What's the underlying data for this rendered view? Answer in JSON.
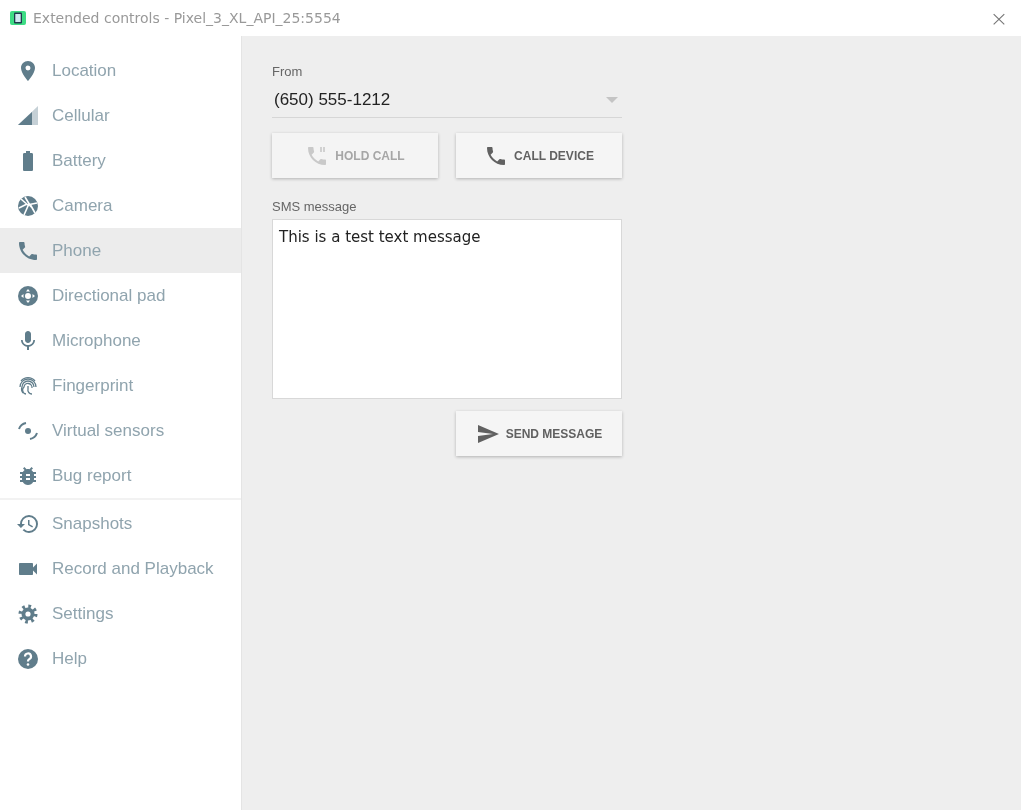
{
  "window": {
    "title": "Extended controls - Pixel_3_XL_API_25:5554",
    "close": "×"
  },
  "sidebar": {
    "groups": [
      {
        "items": [
          {
            "label": "Location",
            "selected": false
          },
          {
            "label": "Cellular",
            "selected": false
          },
          {
            "label": "Battery",
            "selected": false
          },
          {
            "label": "Camera",
            "selected": false
          },
          {
            "label": "Phone",
            "selected": true
          },
          {
            "label": "Directional pad",
            "selected": false
          },
          {
            "label": "Microphone",
            "selected": false
          },
          {
            "label": "Fingerprint",
            "selected": false
          },
          {
            "label": "Virtual sensors",
            "selected": false
          },
          {
            "label": "Bug report",
            "selected": false
          }
        ]
      },
      {
        "items": [
          {
            "label": "Snapshots",
            "selected": false
          },
          {
            "label": "Record and Playback",
            "selected": false
          },
          {
            "label": "Settings",
            "selected": false
          },
          {
            "label": "Help",
            "selected": false
          }
        ]
      }
    ]
  },
  "phone": {
    "from_label": "From",
    "from_value": "(650) 555-1212",
    "call_buttons": [
      {
        "label": "HOLD CALL",
        "disabled": true
      },
      {
        "label": "CALL DEVICE",
        "disabled": false
      }
    ],
    "sms_label": "SMS message",
    "sms_value": "This is a test text message",
    "send_button": {
      "label": "SEND MESSAGE",
      "disabled": false
    }
  }
}
